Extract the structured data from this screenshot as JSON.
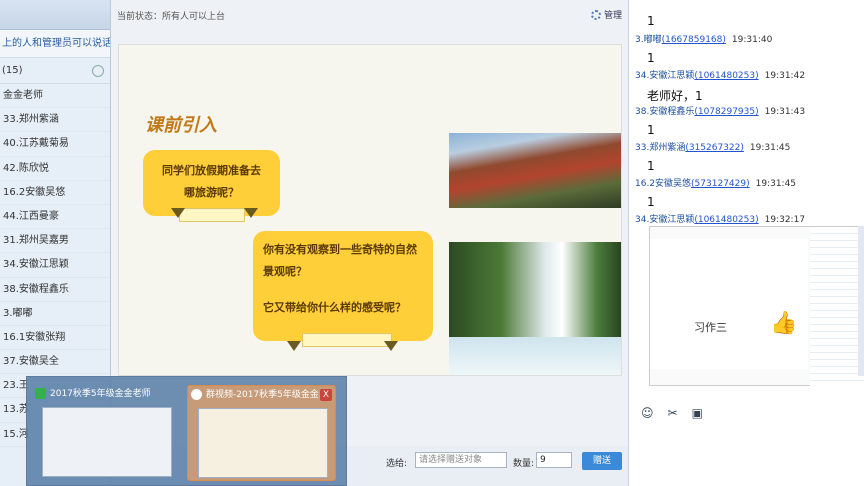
{
  "left_panel": {
    "notice": "上的人和管理员可以说话",
    "count": "(15)",
    "members": [
      "金金老师",
      "33.郑州紫涵",
      "40.江苏戴菊易",
      "42.陈欣悦",
      "16.2安徽吴悠",
      "44.江西曼豪",
      "31.郑州吴嘉男",
      "34.安徽江思颖",
      "38.安徽程鑫乐",
      "3.嘟嘟",
      "16.1安徽张翔",
      "37.安徽吴全",
      "23.王",
      "13.苏",
      "15.河"
    ]
  },
  "center": {
    "status": "当前状态：所有人可以上台",
    "manage_label": "管理",
    "slide": {
      "title": "课前引入",
      "bubble1": "同学们放假期准备去哪旅游呢？",
      "bubble2_line1": "你有没有观察到一些奇特的自然景观呢？",
      "bubble2_line2": "它又带给你什么样的感受呢？"
    },
    "bottom": {
      "send_to_label": "选给:",
      "send_to_placeholder": "请选择赠送对象",
      "quantity_label": "数量:",
      "quantity_value": "9",
      "send_button": "赠送"
    }
  },
  "taskbar_preview": {
    "items": [
      {
        "title": "2017秋季5年级金金老师",
        "icon_color": "#35b04a"
      },
      {
        "title": "群视频-2017秋季5年级金金...",
        "icon_color": "#ffffff"
      }
    ],
    "close_label": "X"
  },
  "chat": {
    "messages": [
      {
        "text": "1",
        "name": "",
        "qq": "",
        "time": ""
      },
      {
        "text": "1",
        "name": "3.嘟嘟",
        "qq": "(1667859168)",
        "time": "19:31:40"
      },
      {
        "text": "老师好，1",
        "name": "34.安徽江思颖",
        "qq": "(1061480253)",
        "time": "19:31:42"
      },
      {
        "text": "1",
        "name": "38.安徽程鑫乐",
        "qq": "(1078297935)",
        "time": "19:31:43"
      },
      {
        "text": "1",
        "name": "33.郑州紫涵",
        "qq": "(315267322)",
        "time": "19:31:45"
      },
      {
        "text": "1",
        "name": "16.2安徽吴悠",
        "qq": "(573127429)",
        "time": "19:31:45"
      },
      {
        "text": "",
        "name": "34.安徽江思颖",
        "qq": "(1061480253)",
        "time": "19:32:17"
      }
    ],
    "screenshot_caption": "习作三",
    "tool_icons": [
      "emoji-icon",
      "scissors-icon",
      "image-icon"
    ]
  }
}
